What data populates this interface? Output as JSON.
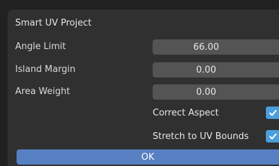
{
  "dialog": {
    "title": "Smart UV Project",
    "fields": [
      {
        "label": "Angle Limit",
        "value": "66.00"
      },
      {
        "label": "Island Margin",
        "value": "0.00"
      },
      {
        "label": "Area Weight",
        "value": "0.00"
      }
    ],
    "checkboxes": [
      {
        "label": "Correct Aspect",
        "checked": true,
        "icon": "checkmark-icon"
      },
      {
        "label": "Stretch to UV Bounds",
        "checked": true,
        "icon": "checkmark-icon"
      }
    ],
    "ok_label": "OK",
    "colors": {
      "background": "#212121",
      "panel": "#303030",
      "field": "#545454",
      "checkbox": "#4a9fdc",
      "ok_button": "#5680c2"
    }
  }
}
